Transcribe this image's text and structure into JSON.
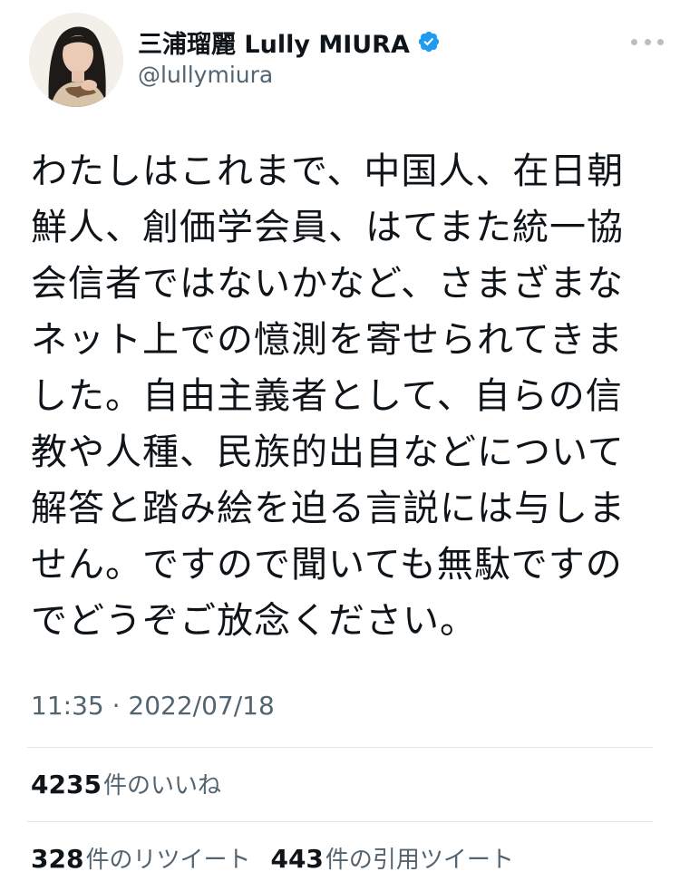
{
  "author": {
    "display_name": "三浦瑠麗 Lully MIURA",
    "handle": "@lullymiura",
    "verified_icon": "verified-badge-icon",
    "verified_color": "#1d9bf0"
  },
  "tweet": {
    "text": "わたしはこれまで、中国人、在日朝鮮人、創価学会員、はてまた統一協会信者ではないかなど、さまざまなネット上での憶測を寄せられてきました。自由主義者として、自らの信教や人種、民族的出自などについて解答と踏み絵を迫る言説には与しません。ですので聞いても無駄ですのでどうぞご放念ください。",
    "timestamp": "11:35 · 2022/07/18"
  },
  "stats": {
    "likes_count": "4235",
    "likes_label": "件のいいね",
    "retweets_count": "328",
    "retweets_label": "件のリツイート",
    "quotes_count": "443",
    "quotes_label": "件の引用ツイート"
  },
  "colors": {
    "text_primary": "#0f1419",
    "text_secondary": "#536471",
    "divider": "#e1e6ea",
    "accent": "#1d9bf0"
  }
}
